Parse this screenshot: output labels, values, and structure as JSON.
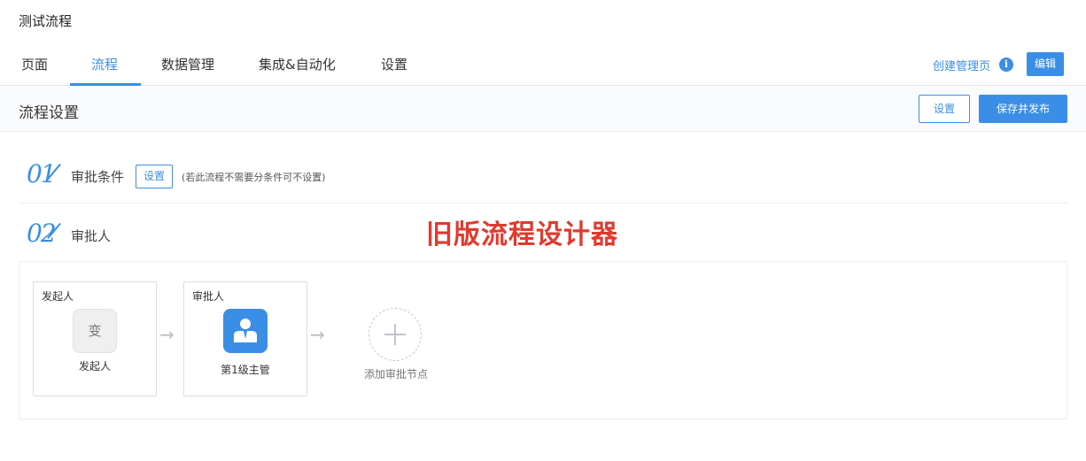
{
  "app": {
    "title": "测试流程"
  },
  "tabs": [
    {
      "label": "页面",
      "active": false
    },
    {
      "label": "流程",
      "active": true
    },
    {
      "label": "数据管理",
      "active": false
    },
    {
      "label": "集成&自动化",
      "active": false
    },
    {
      "label": "设置",
      "active": false
    }
  ],
  "header_actions": {
    "create_link": "创建管理页",
    "info_icon": "i",
    "edit_label": "编辑"
  },
  "section": {
    "title": "流程设置",
    "settings_label": "设置",
    "publish_label": "保存并发布"
  },
  "steps": [
    {
      "number": "01",
      "label": "审批条件",
      "button_label": "设置",
      "hint": "(若此流程不需要分条件可不设置)"
    },
    {
      "number": "02",
      "label": "审批人"
    }
  ],
  "annotation": "旧版流程设计器",
  "flow": {
    "nodes": [
      {
        "header": "发起人",
        "avatar_text": "变",
        "caption": "发起人",
        "icon": "initiator-avatar"
      },
      {
        "header": "审批人",
        "caption": "第1级主管",
        "icon": "person-icon"
      }
    ],
    "arrow_glyph": "→",
    "add_label": "添加审批节点",
    "add_icon": "plus-icon"
  },
  "colors": {
    "accent": "#3a8ee6",
    "annotation": "#e03a2e"
  }
}
